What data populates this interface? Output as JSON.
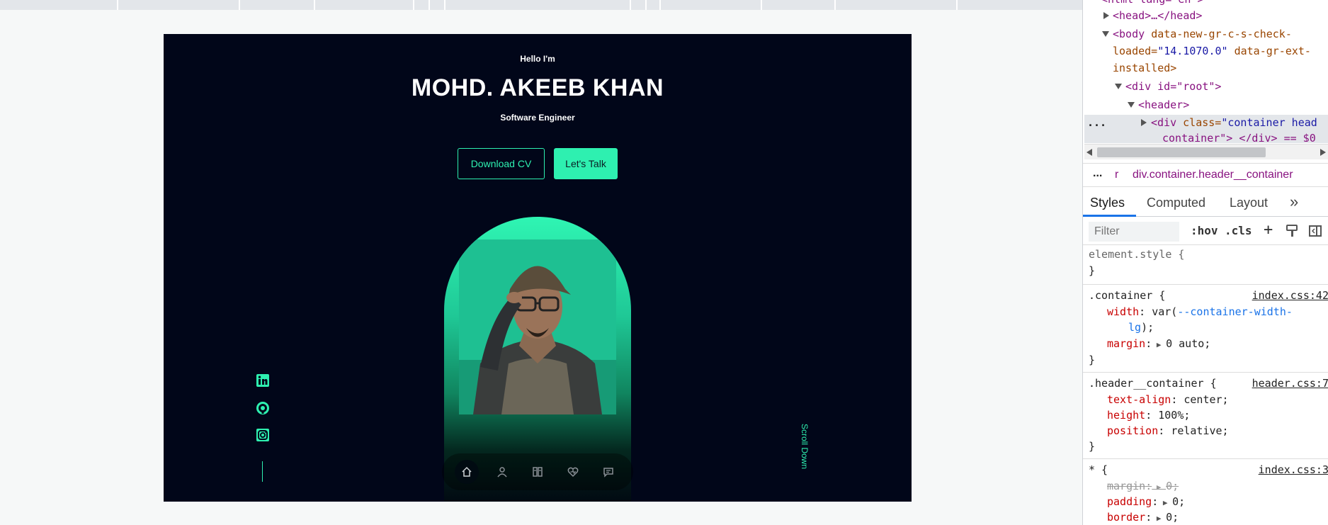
{
  "page": {
    "intro": "Hello I'm",
    "name": "MOHD. AKEEB KHAN",
    "role": "Software Engineer",
    "cta": {
      "download_label": "Download CV",
      "talk_label": "Let's Talk"
    },
    "scroll_label": "Scroll Down",
    "social": [
      "linkedin-icon",
      "github-icon",
      "instagram-icon"
    ],
    "nav": [
      "home-icon",
      "user-icon",
      "book-icon",
      "heart-icon",
      "chat-icon"
    ],
    "accent": "#2ef0b0",
    "background": "#010619"
  },
  "devtools": {
    "dom": {
      "html_line": "<html lang=\"en\">",
      "head_line": "<head>…</head>",
      "body_open": "<body",
      "body_attr1": "data-new-gr-c-s-check-",
      "body_attr1b": "loaded=",
      "body_val1": "\"14.1070.0\"",
      "body_attr2": "data-gr-ext-",
      "body_attr2b": "installed>",
      "root_line": "<div id=\"root\">",
      "header_line": "<header>",
      "container_tag": "<div",
      "container_attr": "class=",
      "container_val": "\"container head",
      "container_line2": "container\"> </div> == $0",
      "ellipsis": "..."
    },
    "breadcrumb": {
      "ellipsis": "...",
      "prev": "r",
      "current": "div.container.header__container"
    },
    "tabs": [
      "Styles",
      "Computed",
      "Layout"
    ],
    "more_tabs": "»",
    "filter_placeholder": "Filter",
    "hov": ":hov",
    "cls": ".cls",
    "rules": {
      "element_style": "element.style {",
      "close": "}",
      "container_selector": ".container {",
      "container_src": "index.css:42",
      "width_prop": "width",
      "width_val_a": "var(",
      "width_var": "--container-width-",
      "width_var_b": "lg",
      "width_val_b": ");",
      "margin_prop": "margin",
      "margin_val": "0 auto;",
      "header_selector": ".header__container {",
      "header_src": "header.css:7",
      "text_align_prop": "text-align",
      "text_align_val": "center;",
      "height_prop": "height",
      "height_val": "100%;",
      "position_prop": "position",
      "position_val": "relative;",
      "star_selector": "* {",
      "star_src": "index.css:3",
      "star_margin_prop": "margin",
      "star_margin_val": "0;",
      "padding_prop": "padding",
      "padding_val": "0;",
      "border_prop": "border",
      "border_val": "0;"
    }
  }
}
